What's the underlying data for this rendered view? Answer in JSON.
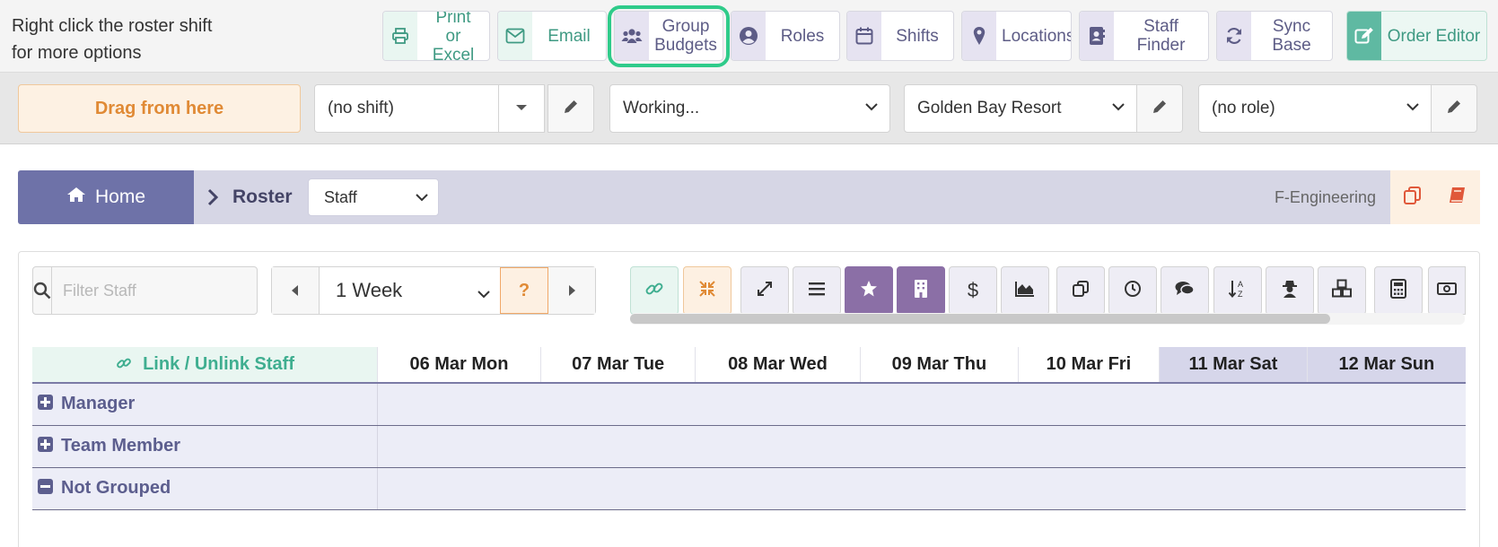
{
  "toolbar": {
    "hint": "Right click the roster shift\nfor more options",
    "buttons": [
      {
        "label": "Print\nor Excel",
        "icon": "printer-icon"
      },
      {
        "label": "Email",
        "icon": "envelope-icon"
      },
      {
        "label": "Group\nBudgets",
        "icon": "users-icon"
      },
      {
        "label": "Roles",
        "icon": "user-circle-icon"
      },
      {
        "label": "Shifts",
        "icon": "calendar-icon"
      },
      {
        "label": "Locations",
        "icon": "map-pin-icon"
      },
      {
        "label": "Staff Finder",
        "icon": "address-book-icon"
      },
      {
        "label": "Sync Base",
        "icon": "sync-icon"
      },
      {
        "label": "Order Editor",
        "icon": "edit-icon"
      }
    ]
  },
  "selectors": {
    "drag": "Drag from here",
    "shift": "(no shift)",
    "status": "Working...",
    "location": "Golden Bay Resort",
    "role": "(no role)"
  },
  "breadcrumb": {
    "home": "Home",
    "roster": "Roster",
    "view": "Staff",
    "department": "F-Engineering"
  },
  "controls": {
    "filter_placeholder": "Filter Staff",
    "period": "1 Week",
    "help": "?",
    "currency": "$"
  },
  "grid": {
    "link_label": "Link / Unlink Staff",
    "days": [
      "06 Mar Mon",
      "07 Mar Tue",
      "08 Mar Wed",
      "09 Mar Thu",
      "10 Mar Fri",
      "11 Mar Sat",
      "12 Mar Sun"
    ],
    "groups": [
      "Manager",
      "Team Member",
      "Not Grouped"
    ]
  },
  "colors": {
    "accent_purple": "#6e72a8",
    "accent_green": "#3f9a83",
    "accent_orange": "#e08a35",
    "focus_ring": "#2fcb8a"
  }
}
